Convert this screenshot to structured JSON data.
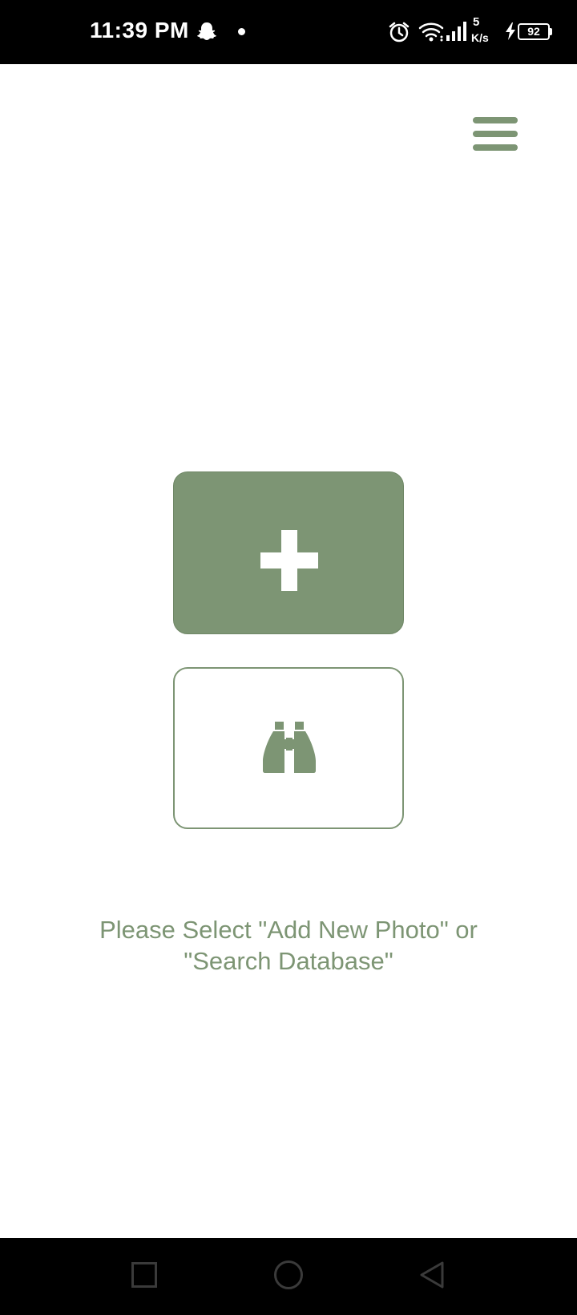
{
  "status_bar": {
    "time": "11:39 PM",
    "speed_value": "5",
    "speed_unit": "K/s",
    "battery": "92"
  },
  "icons": {
    "menu": "hamburger-menu-icon",
    "add": "plus-icon",
    "search": "binoculars-icon"
  },
  "main": {
    "instruction_line1": "Please Select \"Add New Photo\" or",
    "instruction_line2": "\"Search Database\""
  },
  "colors": {
    "accent": "#7d9574",
    "background": "#ffffff",
    "system_bars": "#000000"
  }
}
